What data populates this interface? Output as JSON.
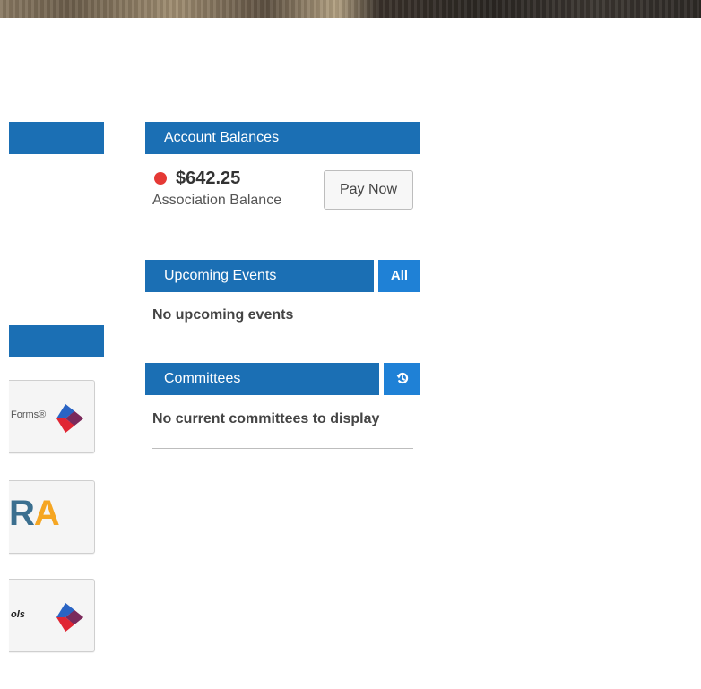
{
  "account_balances": {
    "title": "Account Balances",
    "amount": "$642.25",
    "label": "Association Balance",
    "pay_button": "Pay Now",
    "status_color": "#e53935"
  },
  "upcoming_events": {
    "title": "Upcoming Events",
    "all_button": "All",
    "empty_message": "No upcoming events"
  },
  "committees": {
    "title": "Committees",
    "refresh_icon": "refresh-icon",
    "empty_message": "No current committees to display"
  },
  "left_tiles": [
    {
      "text": "Forms®",
      "icon": "diamond-logo-icon"
    },
    {
      "text": "ARA",
      "icon": "ara-logo"
    },
    {
      "text": "ols",
      "icon": "diamond-logo-icon"
    }
  ],
  "colors": {
    "header_blue": "#1b6fb4",
    "button_blue": "#1f81d6"
  }
}
